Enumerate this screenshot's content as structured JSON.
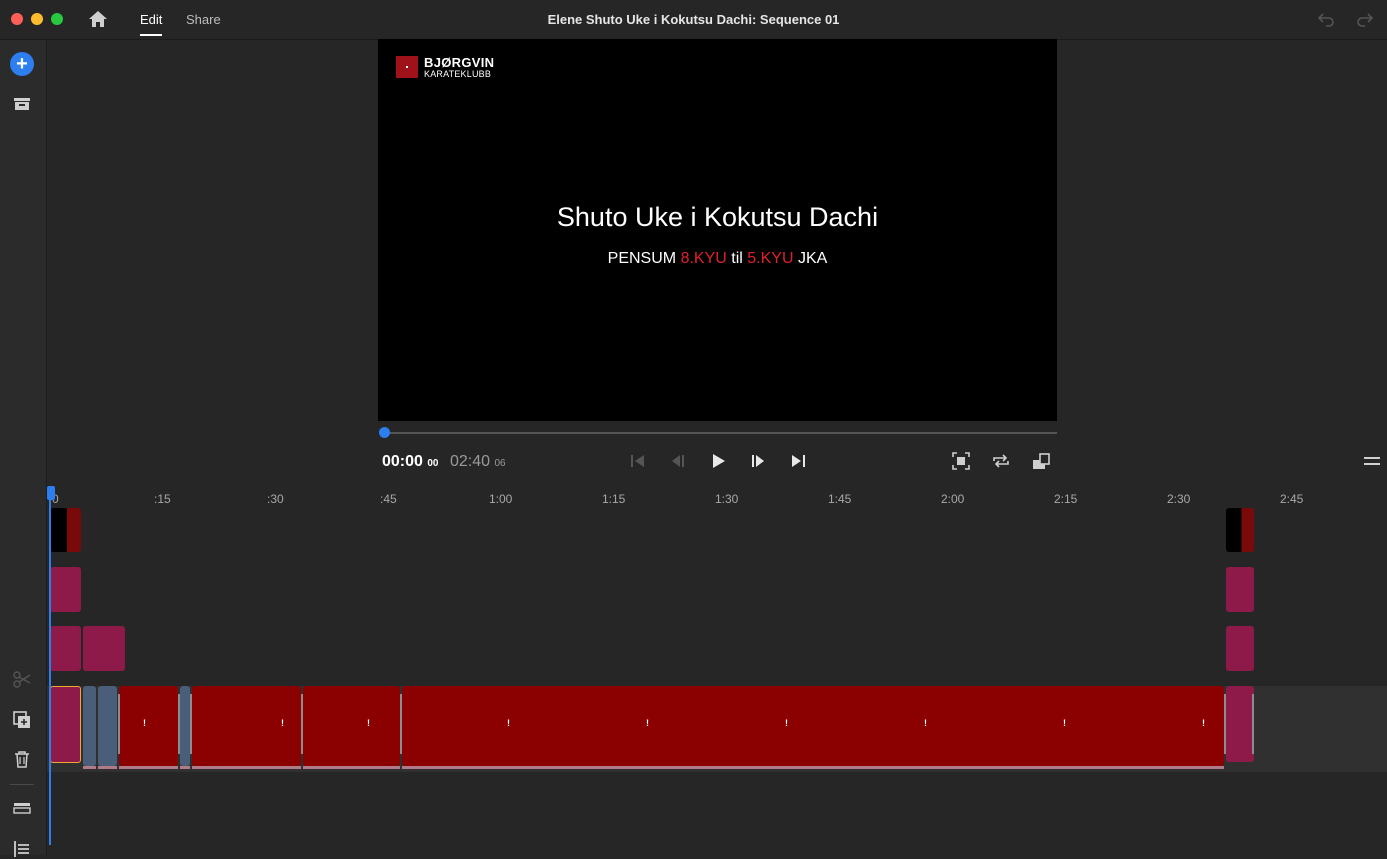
{
  "window": {
    "title": "Elene Shuto Uke i Kokutsu Dachi: Sequence 01",
    "tabs": [
      {
        "label": "Edit",
        "active": true
      },
      {
        "label": "Share",
        "active": false
      }
    ]
  },
  "left_toolbar": {
    "icons": [
      "add-media-icon",
      "project-assets-icon",
      "split-icon",
      "duplicate-icon",
      "trash-icon",
      "track-settings-icon",
      "timeline-list-icon"
    ]
  },
  "monitor": {
    "logo_line1": "BJØRGVIN",
    "logo_line2": "KARATEKLUBB",
    "title": "Shuto Uke i Kokutsu Dachi",
    "subtitle_prefix": "PENSUM",
    "subtitle_kyu1": "8.KYU",
    "subtitle_til": "til",
    "subtitle_kyu2": "5.KYU",
    "subtitle_suffix": "JKA",
    "accent_color": "#e0202a"
  },
  "transport": {
    "current_time": "00:00",
    "current_frames": "00",
    "duration_time": "02:40",
    "duration_frames": "06",
    "playhead_progress": 0.0,
    "buttons": [
      "go-to-start",
      "step-back",
      "play",
      "step-forward",
      "go-to-end",
      "fit-to-screen",
      "loop",
      "aspect"
    ]
  },
  "timeline": {
    "ruler_labels": [
      "0",
      ":15",
      ":30",
      ":45",
      "1:00",
      "1:15",
      "1:30",
      "1:45",
      "2:00",
      "2:15",
      "2:30",
      "2:45"
    ],
    "clip_colors": {
      "video": "#8b0000",
      "audio_blue": "#4a5d79",
      "graphic": "#8e1a4a",
      "selected_border": "#f0a830",
      "playhead": "#2d7ff0"
    }
  }
}
